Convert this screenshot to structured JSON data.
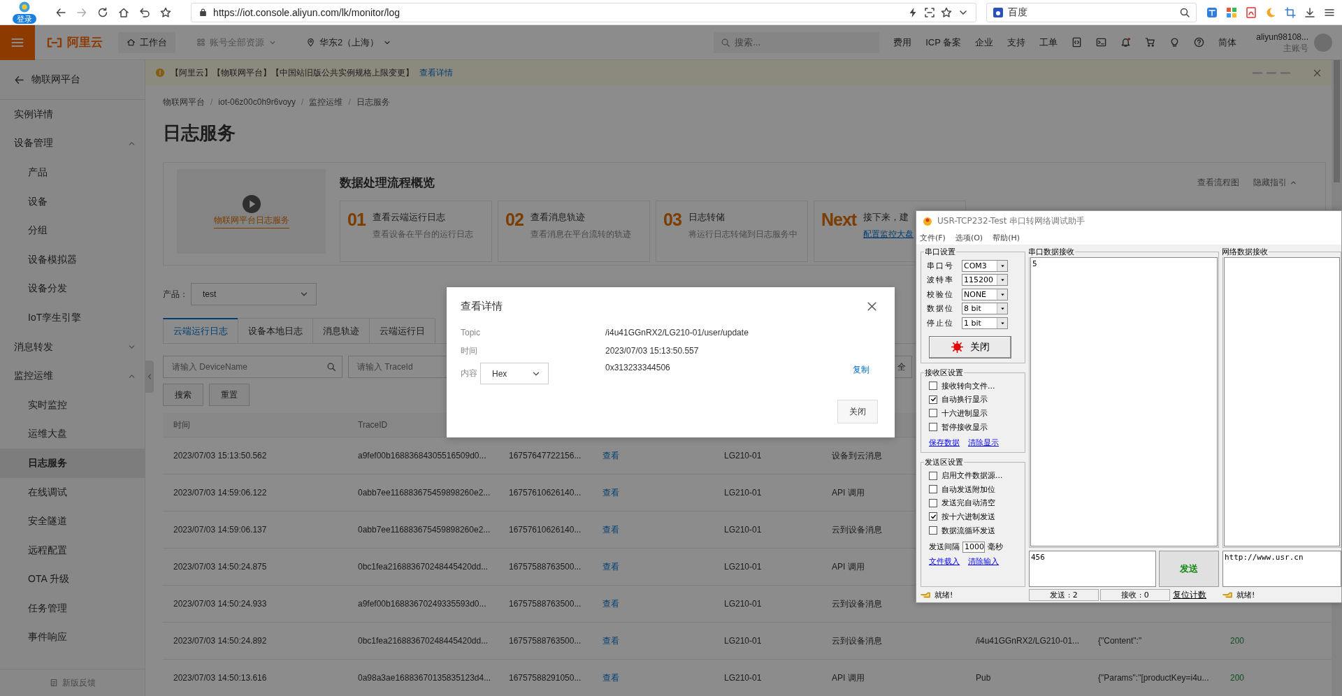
{
  "browser": {
    "profile_label": "登录",
    "url": "https://iot.console.aliyun.com/lk/monitor/log",
    "search_engine": "百度"
  },
  "topnav": {
    "logo": "阿里云",
    "workbench": "工作台",
    "resources": "账号全部资源",
    "region": "华东2（上海）",
    "search_placeholder": "搜索...",
    "links": [
      "费用",
      "ICP 备案",
      "企业",
      "支持",
      "工单"
    ],
    "language": "简体",
    "account": "aliyun98108...",
    "account_role": "主账号"
  },
  "notice": {
    "text": "【阿里云】【物联网平台】【中国站旧版公共实例规格上限变更】",
    "link": "查看详情"
  },
  "sidebar": {
    "back_label": "物联网平台",
    "items": [
      {
        "label": "实例详情",
        "kind": "link",
        "selected": false
      },
      {
        "label": "设备管理",
        "kind": "group",
        "expanded": true,
        "children": [
          {
            "label": "产品",
            "selected": false
          },
          {
            "label": "设备",
            "selected": false
          },
          {
            "label": "分组",
            "selected": false
          },
          {
            "label": "设备模拟器",
            "selected": false
          },
          {
            "label": "设备分发",
            "selected": false
          },
          {
            "label": "IoT孪生引擎",
            "selected": false
          }
        ]
      },
      {
        "label": "消息转发",
        "kind": "group",
        "expanded": false
      },
      {
        "label": "监控运维",
        "kind": "group",
        "expanded": true,
        "children": [
          {
            "label": "实时监控",
            "selected": false
          },
          {
            "label": "运维大盘",
            "selected": false
          },
          {
            "label": "日志服务",
            "selected": true
          },
          {
            "label": "在线调试",
            "selected": false
          },
          {
            "label": "安全隧道",
            "selected": false
          },
          {
            "label": "远程配置",
            "selected": false
          },
          {
            "label": "OTA 升级",
            "selected": false
          },
          {
            "label": "任务管理",
            "selected": false
          },
          {
            "label": "事件响应",
            "selected": false
          }
        ]
      }
    ],
    "feedback": "新版反馈"
  },
  "breadcrumb": [
    "物联网平台",
    "iot-06z00c0h9r6voyy",
    "监控运维",
    "日志服务"
  ],
  "breadcrumb_separator": "/",
  "title": "日志服务",
  "overview": {
    "video_title": "物联网平台日志服务",
    "title": "数据处理流程概览",
    "actions": [
      "查看流程图",
      "隐藏指引"
    ],
    "steps": [
      {
        "number": "01",
        "title": "查看云端运行日志",
        "description": "查看设备在平台的运行日志"
      },
      {
        "number": "02",
        "title": "查看消息轨迹",
        "description": "查看消息在平台流转的轨迹"
      },
      {
        "number": "03",
        "title": "日志转储",
        "description": "将运行日志转储到日志服务中"
      },
      {
        "number": "Next",
        "title": "接下来，建",
        "link": "配置监控大盘"
      }
    ]
  },
  "filter": {
    "product_label": "产品：",
    "product": "test"
  },
  "tabs": [
    {
      "label": "云端运行日志",
      "selected": true
    },
    {
      "label": "设备本地日志",
      "selected": false
    },
    {
      "label": "消息轨迹",
      "selected": false
    },
    {
      "label": "云端运行日",
      "selected": false
    }
  ],
  "search": {
    "device_placeholder": "请输入 DeviceName",
    "trace_placeholder": "请输入 TraceId",
    "status_select": "全",
    "buttons": [
      "搜索",
      "重置"
    ]
  },
  "table": {
    "columns": [
      "时间",
      "TraceID"
    ],
    "rows": [
      {
        "time": "2023/07/03 15:13:50.562",
        "trace_id": "a9fef00b16883684305516509d0...",
        "column_3": "16757647722156...",
        "column_4": "查看",
        "column_5": "LG210-01",
        "column_6": "设备到云消息"
      },
      {
        "time": "2023/07/03 14:59:06.122",
        "trace_id": "0abb7ee116883675459898260e2...",
        "column_3": "16757610626140...",
        "column_4": "查看",
        "column_5": "LG210-01",
        "column_6": "API 调用"
      },
      {
        "time": "2023/07/03 14:59:06.137",
        "trace_id": "0abb7ee116883675459898260e2...",
        "column_3": "16757610626140...",
        "column_4": "查看",
        "column_5": "LG210-01",
        "column_6": "云到设备消息"
      },
      {
        "time": "2023/07/03 14:50:24.875",
        "trace_id": "0bc1fea216883670248445420dd...",
        "column_3": "16757588763500...",
        "column_4": "查看",
        "column_5": "LG210-01",
        "column_6": "API 调用"
      },
      {
        "time": "2023/07/03 14:50:24.933",
        "trace_id": "a9fef00b16883670249335593d0...",
        "column_3": "16757588763500...",
        "column_4": "查看",
        "column_5": "LG210-01",
        "column_6": "云到设备消息"
      },
      {
        "time": "2023/07/03 14:50:24.892",
        "trace_id": "0bc1fea216883670248445420dd...",
        "column_3": "16757588763500...",
        "column_4": "查看",
        "column_5": "LG210-01",
        "column_6": "云到设备消息",
        "column_7": "/i4u41GGnRX2/LG210-01...",
        "column_8": "{\"Content\":\"",
        "column_9": "200"
      },
      {
        "time": "2023/07/03 14:50:13.616",
        "trace_id": "0a98a3ae16883670135835123d4...",
        "column_3": "16757588291050...",
        "column_4": "查看",
        "column_5": "LG210-01",
        "column_6": "API 调用",
        "column_7": "Pub",
        "column_8": "{\"Params\":\"[productKey=i4u...",
        "column_9": "200"
      }
    ]
  },
  "modal": {
    "title": "查看详情",
    "fields": [
      {
        "label": "Topic",
        "value": "/i4u41GGnRX2/LG210-01/user/update"
      },
      {
        "label": "时间",
        "value": "2023/07/03 15:13:50.557"
      }
    ],
    "content_label": "内容",
    "content_format": "Hex",
    "content_value": "0x313233344506",
    "copy": "复制",
    "close_button": "关闭"
  },
  "serial_tool": {
    "title": "USR-TCP232-Test 串口转网络调试助手",
    "menu": [
      "文件(F)",
      "选项(O)",
      "帮助(H)"
    ],
    "port_settings": {
      "title": "串口设置",
      "fields": [
        {
          "label": "串口号",
          "value": "COM3"
        },
        {
          "label": "波特率",
          "value": "115200"
        },
        {
          "label": "校验位",
          "value": "NONE"
        },
        {
          "label": "数据位",
          "value": "8 bit"
        },
        {
          "label": "停止位",
          "value": "1 bit"
        }
      ],
      "button": "关闭"
    },
    "receive_settings": {
      "title": "接收区设置",
      "options": [
        {
          "label": "接收转向文件...",
          "checked": false
        },
        {
          "label": "自动换行显示",
          "checked": true
        },
        {
          "label": "十六进制显示",
          "checked": false
        },
        {
          "label": "暂停接收显示",
          "checked": false
        }
      ],
      "links": [
        "保存数据",
        "清除显示"
      ]
    },
    "send_settings": {
      "title": "发送区设置",
      "options": [
        {
          "label": "启用文件数据源...",
          "checked": false
        },
        {
          "label": "自动发送附加位",
          "checked": false
        },
        {
          "label": "发送完自动清空",
          "checked": false
        },
        {
          "label": "按十六进制发送",
          "checked": true
        },
        {
          "label": "数据流循环发送",
          "checked": false
        }
      ],
      "interval_label": "发送间隔",
      "interval": "1000",
      "interval_unit": "毫秒",
      "links": [
        "文件载入",
        "清除输入"
      ]
    },
    "serial_receive": {
      "title": "串口数据接收",
      "content": "5"
    },
    "network_receive": {
      "title": "网络数据接收"
    },
    "send_input": "456",
    "send_button": "发送",
    "network_send": "http://www.usr.cn",
    "status": {
      "left": "就绪!",
      "sent": "发送 : 2",
      "received": "接收 : 0",
      "reset": "复位计数",
      "right": "就绪!"
    }
  }
}
